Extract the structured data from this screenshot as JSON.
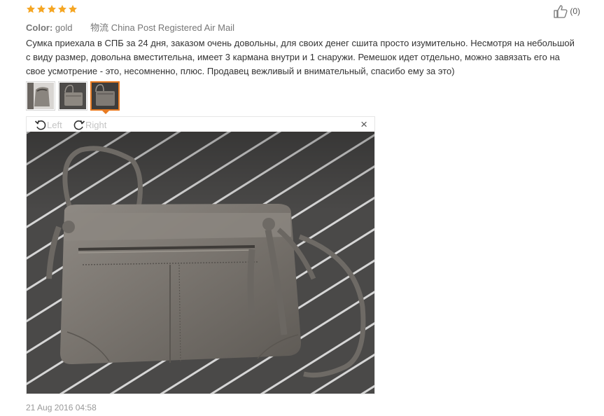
{
  "review": {
    "rating": 5,
    "star_color": "#f5a623",
    "color_label": "Color:",
    "color_value": "gold",
    "shipping": "物流 China Post Registered Air Mail",
    "text": "Сумка приехала в СПБ за 24 дня, заказом очень довольны, для своих денег сшита просто изумительно. Несмотря на небольшой с виду размер, довольна вместительна, имеет 3 кармана внутри и 1 снаружи. Ремешок идет отдельно, можно завязать его на свое усмотрение - это, несомненно, плюс. Продавец вежливый и внимательный, спасибо ему за это)",
    "helpful_count": "(0)",
    "date": "21 Aug 2016 04:58"
  },
  "thumbnails": [
    {
      "name": "photo-1",
      "active": false
    },
    {
      "name": "photo-2",
      "active": false
    },
    {
      "name": "photo-3",
      "active": true
    }
  ],
  "viewer": {
    "rotate_left_label": "Left",
    "rotate_right_label": "Right",
    "close_symbol": "×"
  },
  "icons": {
    "thumbs_up": "thumbs-up-icon",
    "rotate_left": "rotate-left-icon",
    "rotate_right": "rotate-right-icon",
    "close": "close-icon"
  },
  "colors": {
    "accent": "#e87b22",
    "muted_text": "#999999"
  }
}
